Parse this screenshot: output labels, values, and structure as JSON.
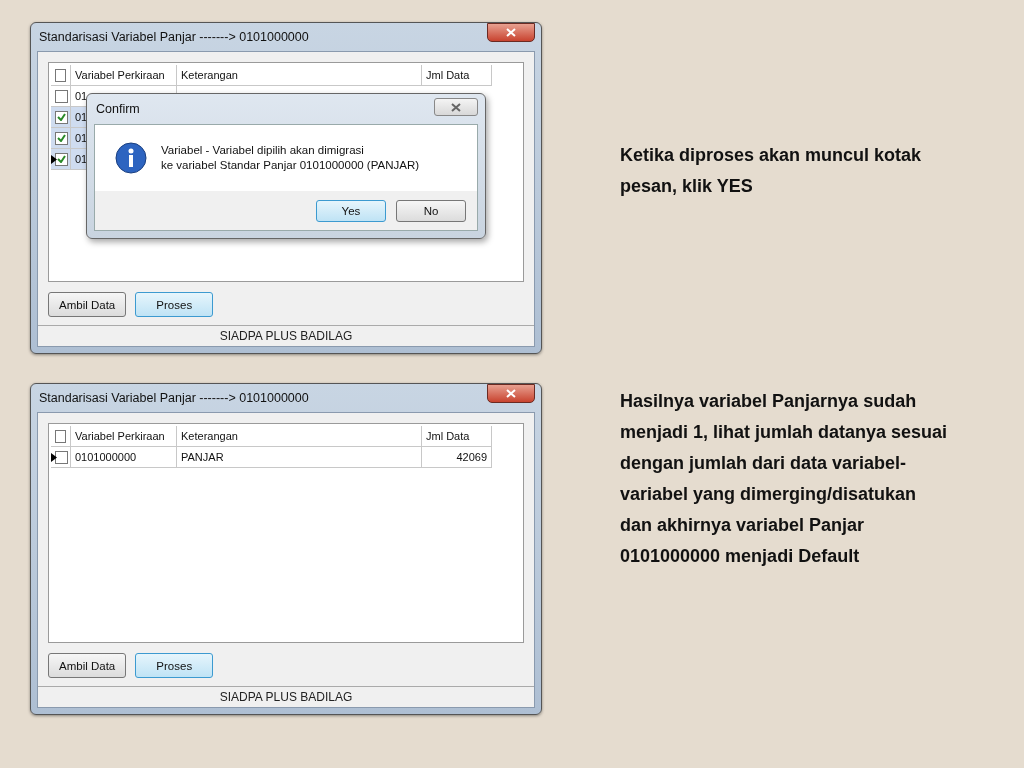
{
  "windows": [
    {
      "title": "Standarisasi Variabel Panjar -------> 0101000000",
      "header_checked": false,
      "columns": [
        "Variabel Perkiraan",
        "Keterangan",
        "Jml Data"
      ],
      "rows": [
        {
          "checked": false,
          "selected": false,
          "current": false,
          "cells": [
            "01"
          ]
        },
        {
          "checked": true,
          "selected": true,
          "current": false,
          "cells": [
            "01"
          ]
        },
        {
          "checked": true,
          "selected": true,
          "current": false,
          "cells": [
            "01"
          ]
        },
        {
          "checked": true,
          "selected": true,
          "current": true,
          "cells": [
            "01"
          ]
        }
      ],
      "dialog": {
        "title": "Confirm",
        "message": "Variabel - Variabel dipilih akan dimigrasi\nke variabel Standar Panjar 0101000000 (PANJAR)",
        "buttons": [
          {
            "label": "Yes",
            "selected": true
          },
          {
            "label": "No",
            "selected": false
          }
        ]
      },
      "buttons": [
        {
          "label": "Ambil Data",
          "selected": false
        },
        {
          "label": "Proses",
          "selected": true
        }
      ],
      "status_bar": "SIADPA PLUS BADILAG"
    },
    {
      "title": "Standarisasi Variabel Panjar -------> 0101000000",
      "header_checked": false,
      "columns": [
        "Variabel Perkiraan",
        "Keterangan",
        "Jml Data"
      ],
      "rows": [
        {
          "checked": false,
          "selected": false,
          "current": true,
          "cells": [
            "0101000000",
            "PANJAR",
            "42069"
          ]
        }
      ],
      "buttons": [
        {
          "label": "Ambil Data",
          "selected": false
        },
        {
          "label": "Proses",
          "selected": true
        }
      ],
      "status_bar": "SIADPA PLUS BADILAG"
    }
  ],
  "captions": [
    "Ketika diproses akan muncul kotak pesan, klik YES",
    "Hasilnya variabel Panjarnya sudah menjadi 1, lihat jumlah datanya sesuai dengan jumlah dari data variabel-variabel yang dimerging/disatukan dan akhirnya variabel Panjar 0101000000 menjadi Default"
  ]
}
